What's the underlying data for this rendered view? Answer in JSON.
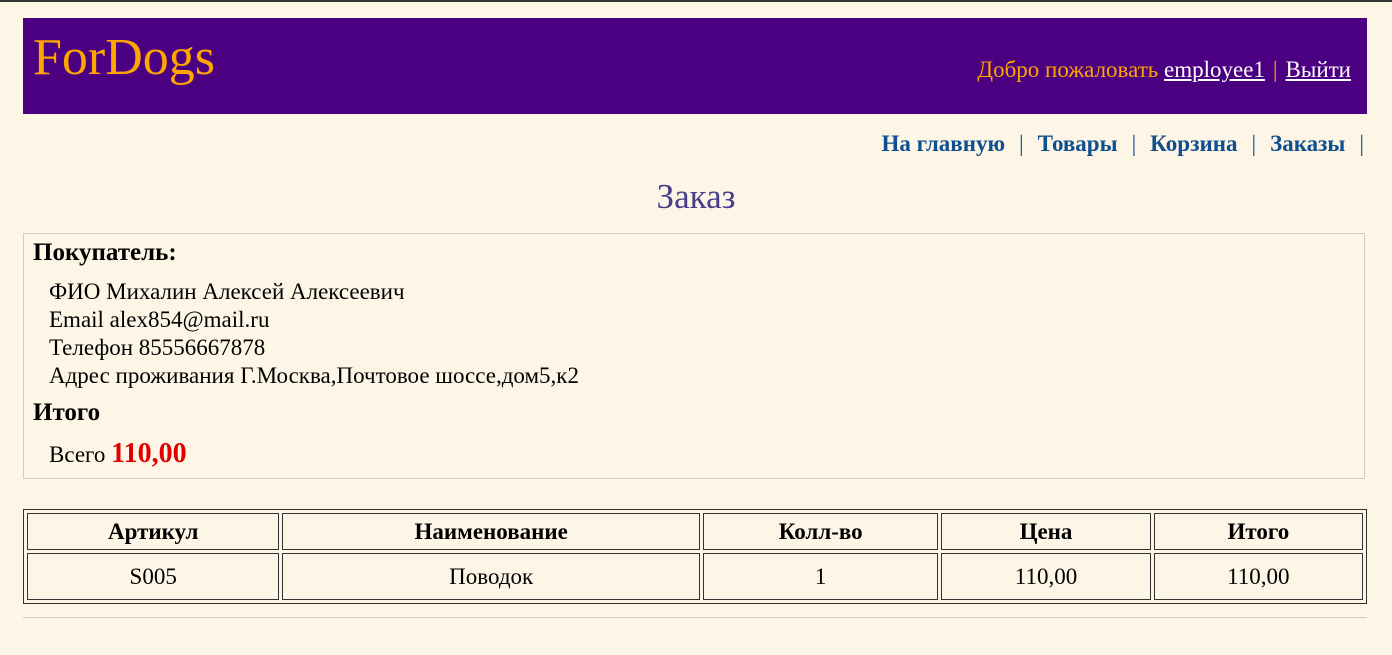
{
  "header": {
    "logo": "ForDogs",
    "welcome_text": "Добро пожаловать",
    "username": "employee1",
    "separator": "|",
    "logout_label": "Выйти"
  },
  "nav": {
    "separator": "|",
    "items": [
      {
        "label": "На главную"
      },
      {
        "label": "Товары"
      },
      {
        "label": "Корзина"
      },
      {
        "label": "Заказы"
      }
    ]
  },
  "page": {
    "title": "Заказ"
  },
  "buyer": {
    "heading": "Покупатель:",
    "lines": [
      "ФИО Михалин Алексей Алексеевич",
      "Email alex854@mail.ru",
      "Телефон 85556667878",
      "Адрес проживания Г.Москва,Почтовое шоссе,дом5,к2"
    ]
  },
  "totals": {
    "heading": "Итого",
    "label": "Всего",
    "value": "110,00"
  },
  "table": {
    "headers": [
      "Артикул",
      "Наименование",
      "Колл-во",
      "Цена",
      "Итого"
    ],
    "rows": [
      [
        "S005",
        "Поводок",
        "1",
        "110,00",
        "110,00"
      ]
    ]
  },
  "colors": {
    "background": "#fdf5e6",
    "header_bg": "#4b0082",
    "logo": "#ffa500",
    "nav_link": "#0d4f8f",
    "title": "#483d8b",
    "total_value": "#e00000"
  }
}
